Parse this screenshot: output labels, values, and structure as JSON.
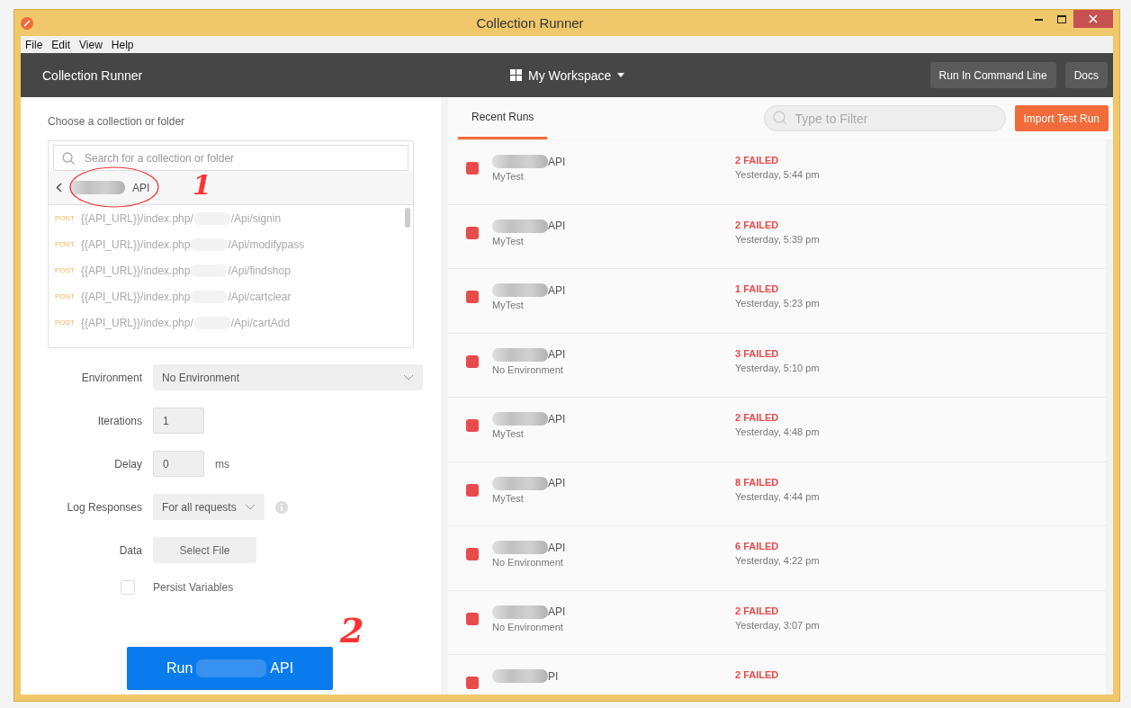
{
  "window": {
    "title": "Collection Runner"
  },
  "menu": [
    "File",
    "Edit",
    "View",
    "Help"
  ],
  "header": {
    "title": "Collection Runner",
    "workspace": "My Workspace",
    "buttons": [
      "Run In Command Line",
      "Docs"
    ]
  },
  "collection_picker": {
    "label": "Choose a collection or folder",
    "search": {
      "placeholder": "Search for a collection or folder"
    },
    "current": "API",
    "annotation": "1",
    "requests": [
      {
        "method": "POST",
        "url_start": "{{API_URL}}/index.php/",
        "url_end": "/Api/signin"
      },
      {
        "method": "POST",
        "url_start": "{{API_URL}}/index.php",
        "url_end": "/Api/modifypass"
      },
      {
        "method": "POST",
        "url_start": "{{API_URL}}/index.php",
        "url_end": "/Api/findshop"
      },
      {
        "method": "POST",
        "url_start": "{{API_URL}}/index.php",
        "url_end": "/Api/cartclear"
      },
      {
        "method": "POST",
        "url_start": "{{API_URL}}/index.php/",
        "url_end": "/Api/cartAdd"
      }
    ]
  },
  "settings": [
    {
      "kind": "select",
      "label": "Environment",
      "value": "No Environment"
    },
    {
      "kind": "input",
      "label": "Iterations",
      "value": "1"
    },
    {
      "kind": "input",
      "label": "Delay",
      "value": "0",
      "unit": "ms"
    },
    {
      "kind": "dropdown",
      "label": "Log Responses",
      "value": "For all requests"
    },
    {
      "kind": "file",
      "label": "Data",
      "value": "Select File"
    },
    {
      "kind": "checkbox",
      "label": "Persist Variables",
      "checked": false
    }
  ],
  "run_button": {
    "prefix": "Run",
    "suffix": "API"
  },
  "run_annotation": "2",
  "tabs": [
    {
      "label": "Recent Runs",
      "selected": true
    }
  ],
  "filter": {
    "placeholder": "Type to Filter"
  },
  "import_button": "Import Test Run",
  "runs": [
    {
      "name": "API",
      "environment": "MyTest",
      "status": "2 FAILED",
      "time": "Yesterday, 5:44 pm",
      "color": "#e84b4b"
    },
    {
      "name": "API",
      "environment": "MyTest",
      "status": "2 FAILED",
      "time": "Yesterday, 5:39 pm",
      "color": "#e84b4b"
    },
    {
      "name": "API",
      "environment": "MyTest",
      "status": "1 FAILED",
      "time": "Yesterday, 5:23 pm",
      "color": "#e84b4b"
    },
    {
      "name": "API",
      "environment": "No Environment",
      "status": "3 FAILED",
      "time": "Yesterday, 5:10 pm",
      "color": "#e84b4b"
    },
    {
      "name": "API",
      "environment": "MyTest",
      "status": "2 FAILED",
      "time": "Yesterday, 4:48 pm",
      "color": "#e84b4b"
    },
    {
      "name": "API",
      "environment": "MyTest",
      "status": "8 FAILED",
      "time": "Yesterday, 4:44 pm",
      "color": "#e84b4b"
    },
    {
      "name": "API",
      "environment": "No Environment",
      "status": "6 FAILED",
      "time": "Yesterday, 4:22 pm",
      "color": "#e84b4b"
    },
    {
      "name": "API",
      "environment": "No Environment",
      "status": "2 FAILED",
      "time": "Yesterday, 3:07 pm",
      "color": "#e84b4b"
    },
    {
      "name": "PI",
      "status": "2 FAILED",
      "color": "#e84b4b"
    }
  ]
}
